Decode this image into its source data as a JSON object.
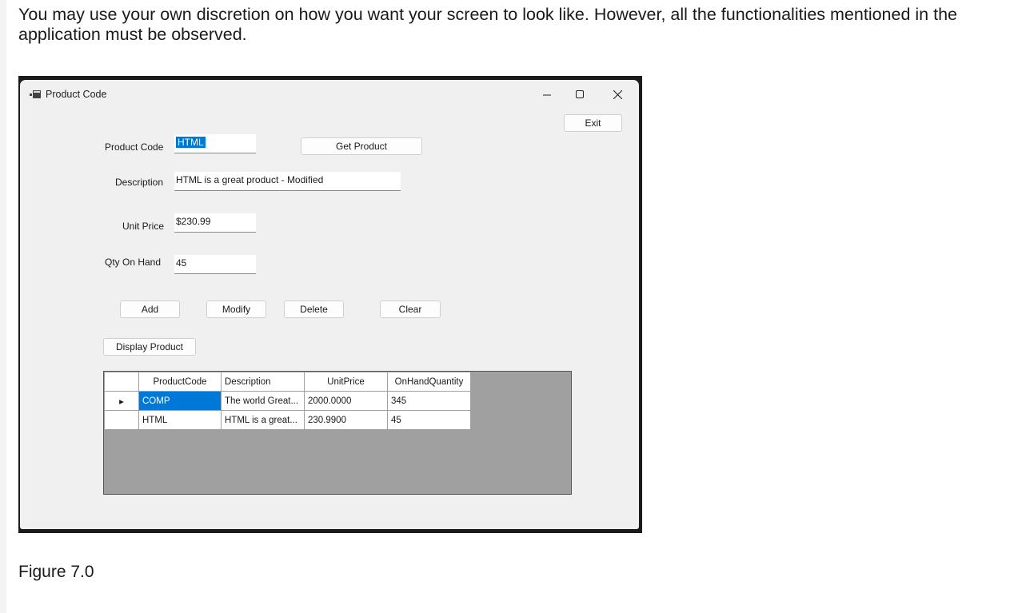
{
  "intro_text": "You may use your own discretion on how you want your screen to look like. However, all the functionalities mentioned in the application must be observed.",
  "figure_caption": "Figure 7.0",
  "window": {
    "title": "Product Code",
    "title_icon": "app-form-icon",
    "controls": {
      "minimize": "–",
      "maximize": "☐",
      "close": "✕"
    }
  },
  "form": {
    "product_code_label": "Product Code",
    "product_code_value": "HTML",
    "description_label": "Description",
    "description_value": "HTML is a great product  - Modified",
    "unit_price_label": "Unit Price",
    "unit_price_value": "$230.99",
    "qty_label": "Qty On Hand",
    "qty_value": "45"
  },
  "buttons": {
    "exit": "Exit",
    "get_product": "Get Product",
    "add": "Add",
    "modify": "Modify",
    "delete": "Delete",
    "clear": "Clear",
    "display_product": "Display Product"
  },
  "grid": {
    "columns": [
      "ProductCode",
      "Description",
      "UnitPrice",
      "OnHandQuantity"
    ],
    "rows": [
      {
        "current_row_marker": "▸",
        "cells": [
          "COMP",
          "The world Great...",
          "2000.0000",
          "345"
        ]
      },
      {
        "current_row_marker": "",
        "cells": [
          "HTML",
          "HTML is a great...",
          "230.9900",
          "45"
        ]
      }
    ]
  },
  "colors": {
    "selection": "#0078d7",
    "window_bg": "#f0f0f0",
    "grid_bg": "#a0a0a0"
  }
}
